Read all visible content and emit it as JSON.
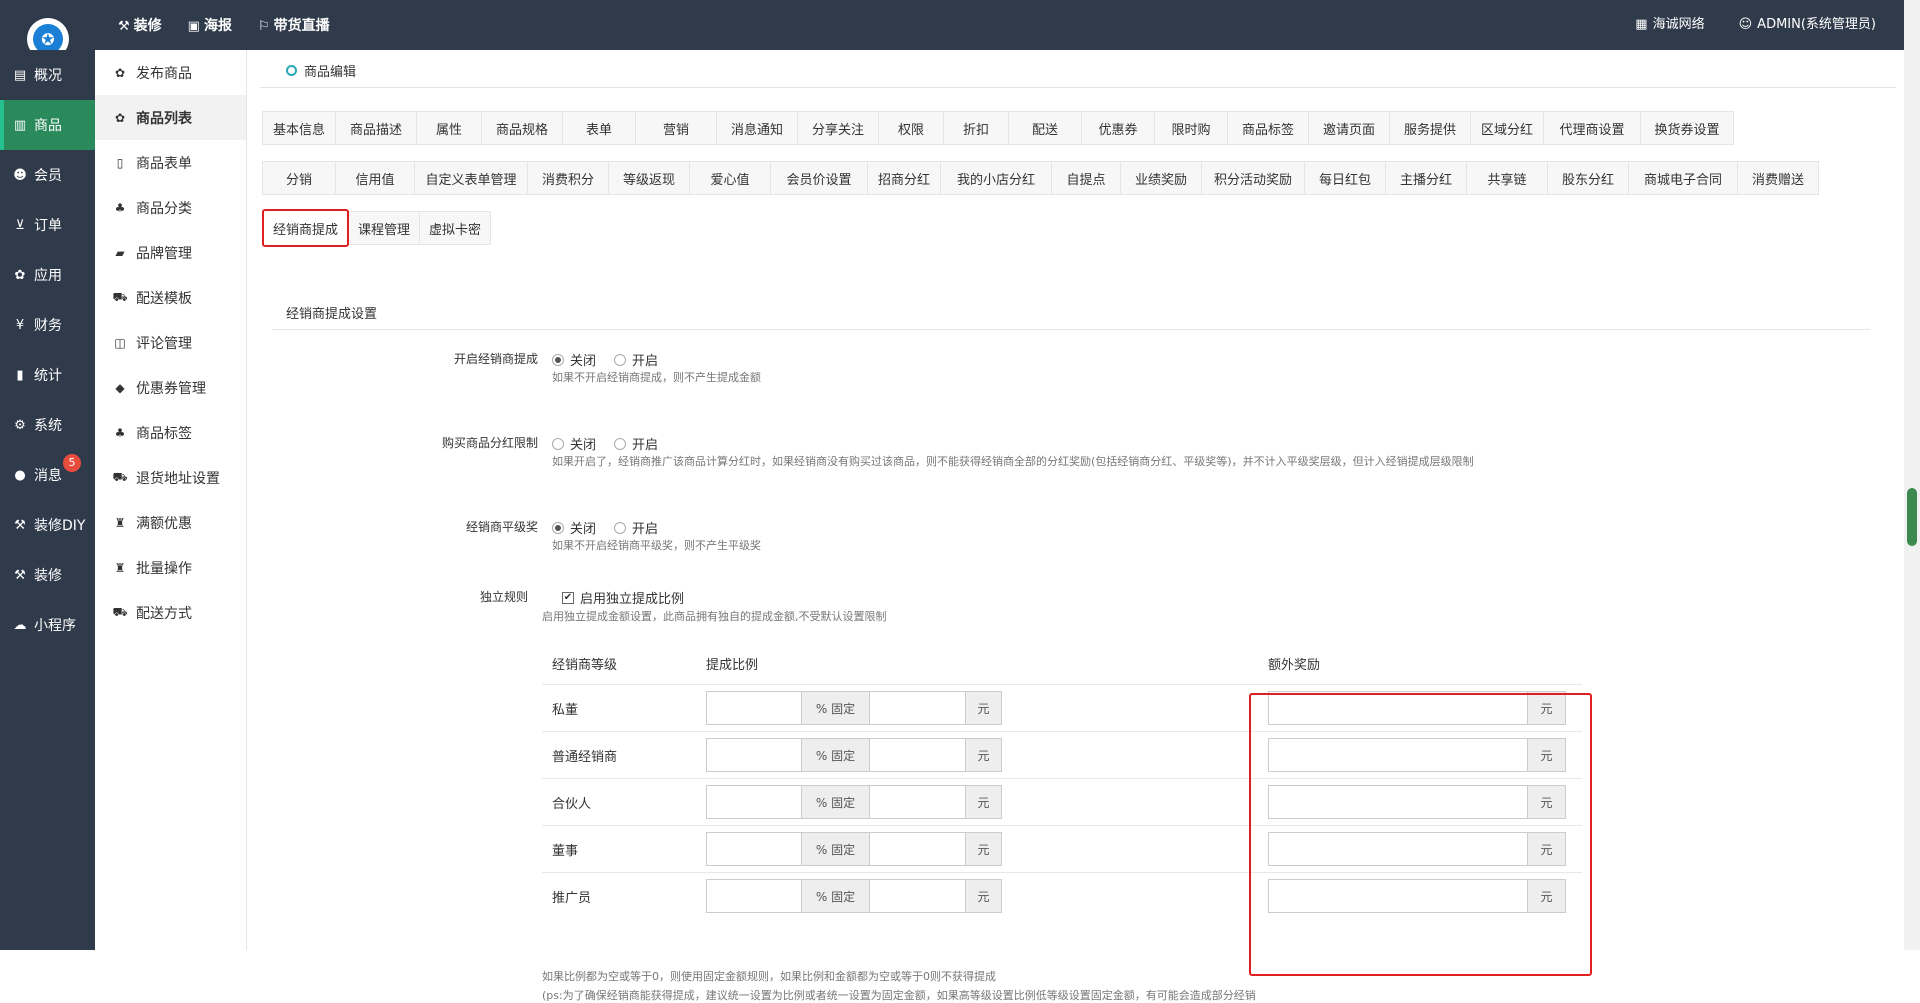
{
  "topbar": {
    "nav": [
      {
        "icon": "hammer-icon",
        "glyph": "⚒",
        "label": "装修"
      },
      {
        "icon": "image-icon",
        "glyph": "▣",
        "label": "海报"
      },
      {
        "icon": "torch-icon",
        "glyph": "⚐",
        "label": "带货直播"
      }
    ],
    "brand": "海诚网络",
    "user": "ADMIN(系统管理员)"
  },
  "leftnav": [
    {
      "icon": "overview-icon",
      "glyph": "▤",
      "label": "概况"
    },
    {
      "icon": "goods-icon",
      "glyph": "▥",
      "label": "商品",
      "active": true
    },
    {
      "icon": "users-icon",
      "glyph": "☻",
      "label": "会员"
    },
    {
      "icon": "cart-icon",
      "glyph": "⊻",
      "label": "订单"
    },
    {
      "icon": "apps-icon",
      "glyph": "✿",
      "label": "应用"
    },
    {
      "icon": "finance-icon",
      "glyph": "¥",
      "label": "财务"
    },
    {
      "icon": "stats-icon",
      "glyph": "▮",
      "label": "统计"
    },
    {
      "icon": "gears-icon",
      "glyph": "⚙",
      "label": "系统"
    },
    {
      "icon": "message-icon",
      "glyph": "●",
      "label": "消息",
      "badge": "5"
    },
    {
      "icon": "hammer-icon",
      "glyph": "⚒",
      "label": "装修DIY"
    },
    {
      "icon": "hammer-icon",
      "glyph": "⚒",
      "label": "装修"
    },
    {
      "icon": "wechat-icon",
      "glyph": "☁",
      "label": "小程序"
    }
  ],
  "subnav": [
    {
      "icon": "cubes-icon",
      "glyph": "✿",
      "label": "发布商品"
    },
    {
      "icon": "cubes-icon",
      "glyph": "✿",
      "label": "商品列表",
      "active": true
    },
    {
      "icon": "file-icon",
      "glyph": "▯",
      "label": "商品表单"
    },
    {
      "icon": "sitemap-icon",
      "glyph": "♣",
      "label": "商品分类"
    },
    {
      "icon": "briefcase-icon",
      "glyph": "▰",
      "label": "品牌管理"
    },
    {
      "icon": "truck-icon",
      "glyph": "⛟",
      "label": "配送模板"
    },
    {
      "icon": "columns-icon",
      "glyph": "◫",
      "label": "评论管理"
    },
    {
      "icon": "tag-icon",
      "glyph": "◆",
      "label": "优惠券管理"
    },
    {
      "icon": "sitemap-icon",
      "glyph": "♣",
      "label": "商品标签"
    },
    {
      "icon": "truck-icon",
      "glyph": "⛟",
      "label": "退货地址设置"
    },
    {
      "icon": "gift-icon",
      "glyph": "♜",
      "label": "满额优惠"
    },
    {
      "icon": "gift-icon",
      "glyph": "♜",
      "label": "批量操作"
    },
    {
      "icon": "truck-icon",
      "glyph": "⛟",
      "label": "配送方式"
    }
  ],
  "breadcrumb": "商品编辑",
  "tabs_row1": [
    "基本信息",
    "商品描述",
    "属性",
    "商品规格",
    "表单",
    "营销",
    "消息通知",
    "分享关注",
    "权限",
    "折扣",
    "配送",
    "优惠券",
    "限时购",
    "商品标签",
    "邀请页面",
    "服务提供",
    "区域分红",
    "代理商设置",
    "换货券设置"
  ],
  "tabs_row2": [
    "分销",
    "信用值",
    "自定义表单管理",
    "消费积分",
    "等级返现",
    "爱心值",
    "会员价设置",
    "招商分红",
    "我的小店分红",
    "自提点",
    "业绩奖励",
    "积分活动奖励",
    "每日红包",
    "主播分红",
    "共享链",
    "股东分红",
    "商城电子合同",
    "消费赠送"
  ],
  "tabs_row3": [
    "经销商提成",
    "课程管理",
    "虚拟卡密"
  ],
  "active_tab": "经销商提成",
  "section_title": "经销商提成设置",
  "fields": {
    "enable": {
      "label": "开启经销商提成",
      "options": [
        "关闭",
        "开启"
      ],
      "selected": "关闭",
      "help": "如果不开启经销商提成，则不产生提成金额"
    },
    "limit": {
      "label": "购买商品分红限制",
      "options": [
        "关闭",
        "开启"
      ],
      "selected": "",
      "help": "如果开启了，经销商推广该商品计算分红时，如果经销商没有购买过该商品，则不能获得经销商全部的分红奖励(包括经销商分红、平级奖等)，并不计入平级奖层级，但计入经销提成层级限制"
    },
    "peer": {
      "label": "经销商平级奖",
      "options": [
        "关闭",
        "开启"
      ],
      "selected": "关闭",
      "help": "如果不开启经销商平级奖，则不产生平级奖"
    },
    "rule": {
      "label": "独立规则",
      "checkbox": "启用独立提成比例",
      "checked": true,
      "help": "启用独立提成金额设置，此商品拥有独自的提成金额,不受默认设置限制"
    }
  },
  "table": {
    "headers": {
      "level": "经销商等级",
      "ratio": "提成比例",
      "extra": "额外奖励"
    },
    "pct_addon": "% 固定",
    "yuan_addon": "元",
    "levels": [
      "私董",
      "普通经销商",
      "合伙人",
      "董事",
      "推广员"
    ]
  },
  "footnotes": [
    "如果比例都为空或等于0，则使用固定金额规则，如果比例和金额都为空或等于0则不获得提成",
    "(ps:为了确保经销商能获得提成，建议统一设置为比例或者统一设置为固定金额，如果高等级设置比例低等级设置固定金额，有可能会造成部分经销"
  ]
}
